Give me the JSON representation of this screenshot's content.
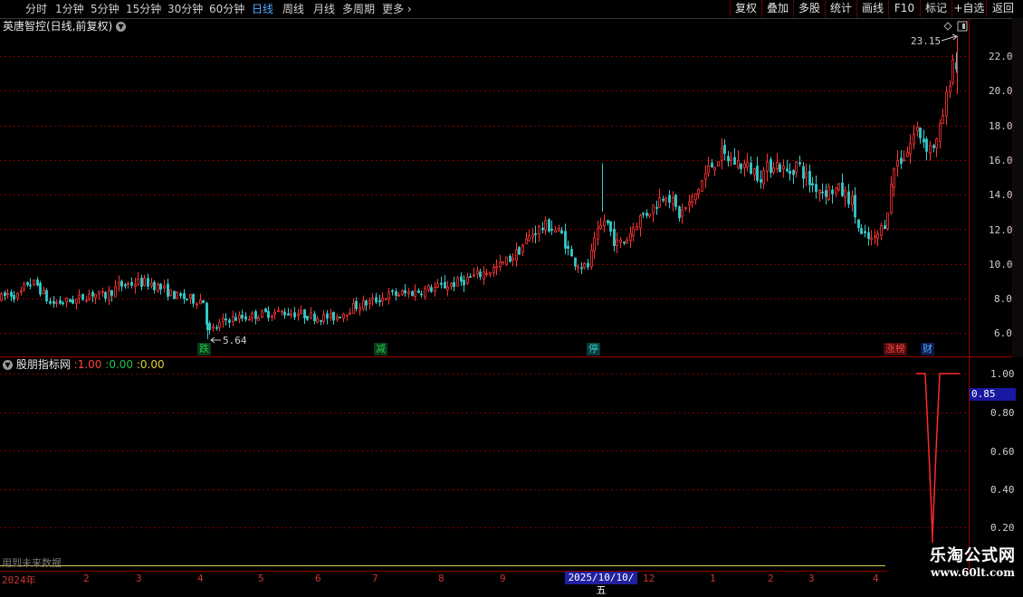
{
  "periods": [
    {
      "label": "分时",
      "active": false
    },
    {
      "label": "1分钟",
      "active": false
    },
    {
      "label": "5分钟",
      "active": false
    },
    {
      "label": "15分钟",
      "active": false
    },
    {
      "label": "30分钟",
      "active": false
    },
    {
      "label": "60分钟",
      "active": false
    },
    {
      "label": "日线",
      "active": true
    },
    {
      "label": "周线",
      "active": false
    },
    {
      "label": "月线",
      "active": false
    },
    {
      "label": "多周期",
      "active": false
    },
    {
      "label": "更多",
      "active": false,
      "icon": "chevron-right-icon"
    }
  ],
  "toolbar": [
    "复权",
    "叠加",
    "多股",
    "统计",
    "画线",
    "F10",
    "标记",
    "+自选",
    "返回"
  ],
  "main_chart": {
    "title": "英唐智控(日线,前复权)",
    "high_label": "23.15",
    "low_label": "5.64",
    "y_ticks": [
      "22.00",
      "20.00",
      "18.00",
      "16.00",
      "14.00",
      "12.00",
      "10.00",
      "8.00",
      "6.00"
    ],
    "signals": [
      {
        "text": "跌",
        "color": "#22c24a"
      },
      {
        "text": "减",
        "color": "#22c24a"
      },
      {
        "text": "停",
        "color": "#33cccc"
      },
      {
        "text": "涨榜",
        "color": "#ff4444"
      },
      {
        "text": "财",
        "color": "#55aaff"
      }
    ]
  },
  "indicator": {
    "name": "股朋指标网",
    "values": [
      "1.00",
      "0.00",
      "0.00"
    ],
    "value_colors": [
      "#ff4444",
      "#22c24a",
      "#e0d040"
    ],
    "y_ticks": [
      "1.00",
      "0.80",
      "0.60",
      "0.40",
      "0.20"
    ],
    "current_value": "0.85"
  },
  "future_note": "用到未来数据",
  "date_axis": {
    "months": [
      "2024年",
      "2",
      "3",
      "4",
      "5",
      "6",
      "7",
      "8",
      "9",
      "12",
      "1",
      "2",
      "3",
      "4"
    ],
    "highlight_date": "2025/10/10/五"
  },
  "watermark": {
    "title": "乐淘公式网",
    "url": "www.60lt.com"
  },
  "chart_data": {
    "type": "candlestick",
    "title": "英唐智控(日线,前复权)",
    "ylim": [
      5.0,
      23.5
    ],
    "y_ticks": [
      6,
      8,
      10,
      12,
      14,
      16,
      18,
      20,
      22
    ],
    "high": 23.15,
    "low": 5.64,
    "up_color": "#ff3333",
    "down_color": "#33cccc",
    "trend": [
      [
        0,
        8.0
      ],
      [
        10,
        8.3
      ],
      [
        20,
        8.1
      ],
      [
        30,
        8.9
      ],
      [
        40,
        8.8
      ],
      [
        55,
        7.7
      ],
      [
        70,
        7.8
      ],
      [
        85,
        7.9
      ],
      [
        100,
        8.3
      ],
      [
        115,
        8.1
      ],
      [
        130,
        8.7
      ],
      [
        150,
        8.9
      ],
      [
        165,
        8.9
      ],
      [
        180,
        8.5
      ],
      [
        195,
        8.1
      ],
      [
        215,
        7.9
      ],
      [
        224,
        7.9
      ],
      [
        230,
        6.0
      ],
      [
        250,
        6.8
      ],
      [
        270,
        6.9
      ],
      [
        290,
        7.1
      ],
      [
        310,
        7.2
      ],
      [
        330,
        7.1
      ],
      [
        350,
        6.9
      ],
      [
        370,
        6.9
      ],
      [
        390,
        7.5
      ],
      [
        410,
        7.8
      ],
      [
        430,
        8.2
      ],
      [
        450,
        8.3
      ],
      [
        470,
        8.5
      ],
      [
        490,
        8.7
      ],
      [
        510,
        9.0
      ],
      [
        530,
        9.4
      ],
      [
        550,
        9.8
      ],
      [
        570,
        10.6
      ],
      [
        590,
        11.9
      ],
      [
        605,
        12.2
      ],
      [
        620,
        11.7
      ],
      [
        632,
        10.2
      ],
      [
        648,
        9.7
      ],
      [
        658,
        11.5
      ],
      [
        668,
        12.6
      ],
      [
        680,
        11.1
      ],
      [
        690,
        11.3
      ],
      [
        705,
        12.6
      ],
      [
        720,
        13.2
      ],
      [
        735,
        14.2
      ],
      [
        750,
        12.8
      ],
      [
        765,
        13.7
      ],
      [
        780,
        15.3
      ],
      [
        795,
        16.3
      ],
      [
        810,
        15.9
      ],
      [
        825,
        15.6
      ],
      [
        840,
        15.1
      ],
      [
        855,
        15.9
      ],
      [
        870,
        15.2
      ],
      [
        880,
        15.8
      ],
      [
        895,
        14.6
      ],
      [
        910,
        14.2
      ],
      [
        925,
        14.3
      ],
      [
        940,
        13.7
      ],
      [
        950,
        11.6
      ],
      [
        965,
        11.3
      ],
      [
        978,
        12.5
      ],
      [
        988,
        15.8
      ],
      [
        1000,
        16.3
      ],
      [
        1012,
        17.8
      ],
      [
        1025,
        16.7
      ],
      [
        1035,
        17.0
      ],
      [
        1045,
        19.5
      ],
      [
        1052,
        21.9
      ],
      [
        1058,
        21.0
      ]
    ],
    "indicator": {
      "name": "股朋指标网",
      "ylim": [
        0.0,
        1.05
      ],
      "y_ticks": [
        0.2,
        0.4,
        0.6,
        0.8,
        1.0
      ],
      "line": [
        [
          1012,
          1.0
        ],
        [
          1022,
          1.0
        ],
        [
          1026,
          0.6
        ],
        [
          1030,
          0.15
        ],
        [
          1034,
          0.6
        ],
        [
          1038,
          1.0
        ],
        [
          1060,
          1.0
        ]
      ]
    }
  }
}
